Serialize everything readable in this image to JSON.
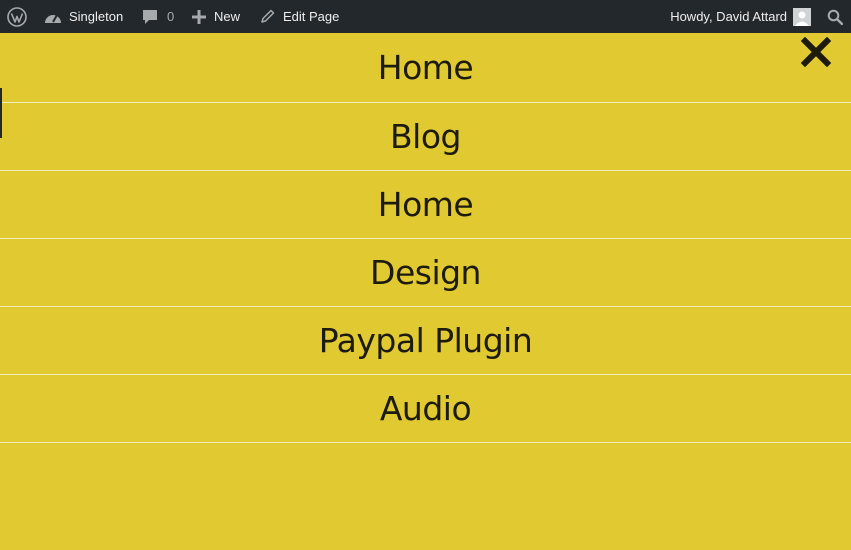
{
  "adminbar": {
    "wp_icon": "wordpress-logo-icon",
    "site_icon": "dashboard-gauge-icon",
    "site_name": "Singleton",
    "comments_icon": "comment-bubble-icon",
    "comments_count": "0",
    "new_icon": "plus-icon",
    "new_label": "New",
    "edit_icon": "pencil-icon",
    "edit_label": "Edit Page",
    "howdy": "Howdy, David Attard",
    "avatar_icon": "user-avatar-icon",
    "search_icon": "search-icon"
  },
  "menu": {
    "close_icon": "close-icon",
    "items": [
      {
        "label": "Home"
      },
      {
        "label": "Blog"
      },
      {
        "label": "Home"
      },
      {
        "label": "Design"
      },
      {
        "label": "Paypal Plugin"
      },
      {
        "label": "Audio"
      }
    ]
  },
  "colors": {
    "adminbar_bg": "#23282d",
    "overlay_bg": "#e1c932",
    "menu_text": "#1d1b0e",
    "divider": "#f3ecb8"
  }
}
